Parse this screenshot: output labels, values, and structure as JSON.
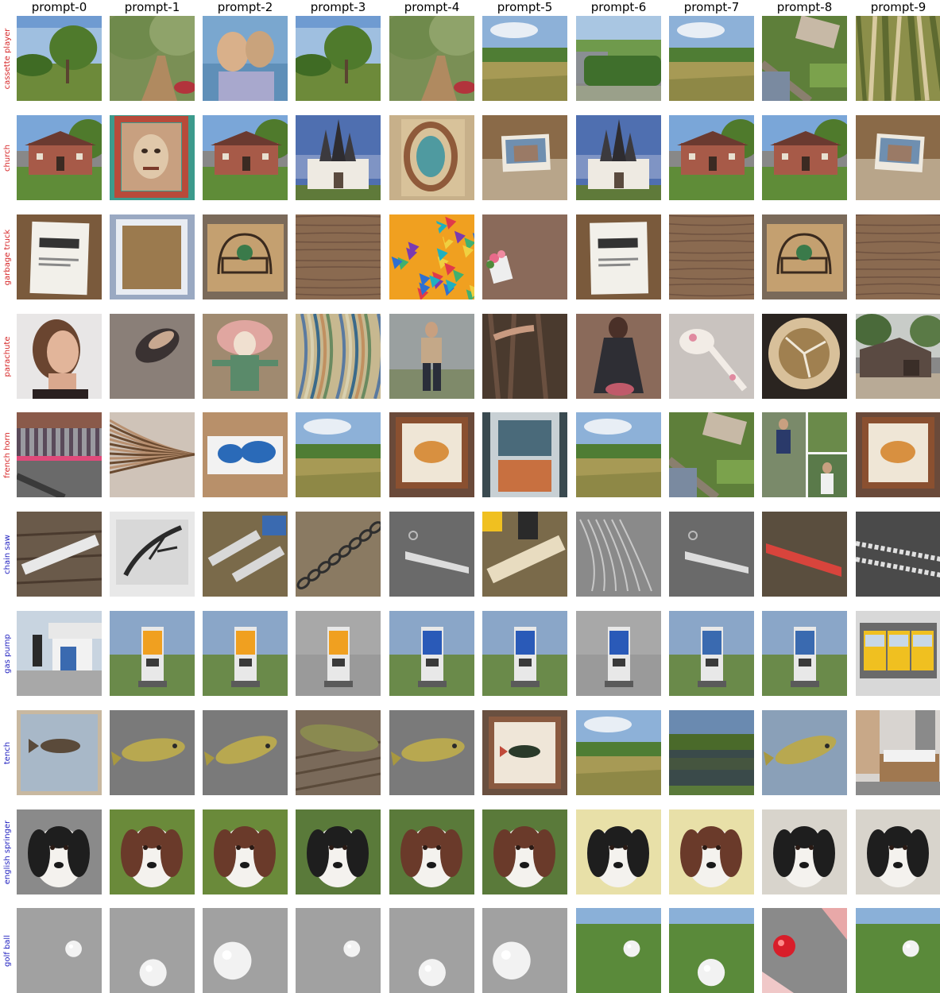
{
  "columns": [
    "prompt-0",
    "prompt-1",
    "prompt-2",
    "prompt-3",
    "prompt-4",
    "prompt-5",
    "prompt-6",
    "prompt-7",
    "prompt-8",
    "prompt-9"
  ],
  "rows": [
    {
      "label": "cassette player",
      "color": "#d62728"
    },
    {
      "label": "church",
      "color": "#d62728"
    },
    {
      "label": "garbage truck",
      "color": "#d62728"
    },
    {
      "label": "parachute",
      "color": "#d62728"
    },
    {
      "label": "french horn",
      "color": "#d62728"
    },
    {
      "label": "chain saw",
      "color": "#1f1fbf"
    },
    {
      "label": "gas pump",
      "color": "#1f1fbf"
    },
    {
      "label": "tench",
      "color": "#1f1fbf"
    },
    {
      "label": "english springer",
      "color": "#1f1fbf"
    },
    {
      "label": "golf ball",
      "color": "#1f1fbf"
    }
  ],
  "cell_visuals": [
    [
      "landscape-trees",
      "landscape-path",
      "painted-faces",
      "landscape-trees",
      "landscape-path",
      "landscape-grass",
      "landscape-hedge",
      "landscape-grass",
      "aerial-view",
      "bamboo-stalks"
    ],
    [
      "brick-house",
      "painted-face-poster",
      "brick-house",
      "white-church",
      "abstract-painting",
      "postcard-on-table",
      "white-church",
      "brick-house",
      "brick-house",
      "postcard-on-table"
    ],
    [
      "paper-sheet",
      "framed-board",
      "cardboard-drawing",
      "wood-texture",
      "colorful-pattern",
      "flowers-on-table",
      "paper-sheet",
      "wood-texture",
      "cardboard-drawing",
      "wood-texture"
    ],
    [
      "woman-portrait",
      "shoe-closeup",
      "painted-figure",
      "striped-fabric",
      "man-standing",
      "forest-hand",
      "woman-dress",
      "ceramic-spoon",
      "bowl-closeup",
      "wooden-shed"
    ],
    [
      "striped-wall",
      "feather-closeup",
      "world-map-sign",
      "landscape-grass",
      "framed-painting",
      "window-closeup",
      "landscape-grass",
      "aerial-view",
      "people-collage",
      "framed-painting"
    ],
    [
      "ruler-on-wood",
      "photo-tree",
      "saw-blades",
      "chain-on-wood",
      "saw-blade",
      "chainsaw-log",
      "chain-pile",
      "saw-blade",
      "red-saw-blade",
      "chain-on-ground"
    ],
    [
      "gas-station",
      "gas-pump",
      "gas-pump",
      "gas-pump",
      "gas-pump",
      "gas-pump",
      "gas-pump",
      "gas-pump",
      "gas-pump",
      "vending-machines"
    ],
    [
      "fish-painting",
      "fish-on-surface",
      "fish-on-surface",
      "fish-on-wood",
      "fish-on-surface",
      "framed-fish",
      "landscape-grass",
      "lake-reflection",
      "fish-on-surface",
      "bedroom"
    ],
    [
      "springer-dog",
      "springer-dog",
      "springer-dog",
      "springer-dog",
      "springer-dog",
      "springer-dog",
      "springer-dog",
      "springer-dog",
      "springer-dog",
      "springer-dog"
    ],
    [
      "golf-ball",
      "golf-ball",
      "golf-ball",
      "golf-ball",
      "golf-ball",
      "golf-ball",
      "golf-ball",
      "golf-ball",
      "red-ball",
      "golf-ball"
    ]
  ]
}
